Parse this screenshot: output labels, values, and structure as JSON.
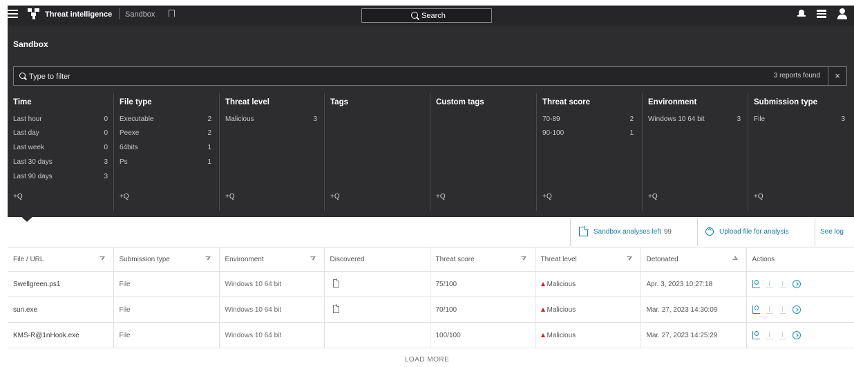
{
  "topbar": {
    "app_title": "Threat intelligence",
    "section": "Sandbox",
    "search_label": "Search"
  },
  "page": {
    "title": "Sandbox"
  },
  "filter": {
    "placeholder": "Type to filter",
    "count_text": "3 reports found",
    "clear_label": "×"
  },
  "facets": [
    {
      "title": "Time",
      "items": [
        {
          "label": "Last hour",
          "count": "0"
        },
        {
          "label": "Last day",
          "count": "0"
        },
        {
          "label": "Last week",
          "count": "0"
        },
        {
          "label": "Last 30 days",
          "count": "3"
        },
        {
          "label": "Last 90 days",
          "count": "3"
        }
      ],
      "add": "+Q"
    },
    {
      "title": "File type",
      "items": [
        {
          "label": "Executable",
          "count": "2"
        },
        {
          "label": "Peexe",
          "count": "2"
        },
        {
          "label": "64bits",
          "count": "1"
        },
        {
          "label": "Ps",
          "count": "1"
        }
      ],
      "add": "+Q"
    },
    {
      "title": "Threat level",
      "items": [
        {
          "label": "Malicious",
          "count": "3"
        }
      ],
      "add": "+Q"
    },
    {
      "title": "Tags",
      "items": [],
      "add": "+Q"
    },
    {
      "title": "Custom tags",
      "items": [],
      "add": "+Q"
    },
    {
      "title": "Threat score",
      "items": [
        {
          "label": "70-89",
          "count": "2"
        },
        {
          "label": "90-100",
          "count": "1"
        }
      ],
      "add": "+Q"
    },
    {
      "title": "Environment",
      "items": [
        {
          "label": "Windows 10 64 bit",
          "count": "3"
        }
      ],
      "add": "+Q"
    },
    {
      "title": "Submission type",
      "items": [
        {
          "label": "File",
          "count": "3"
        }
      ],
      "add": "+Q"
    }
  ],
  "actions": {
    "sandbox_label": "Sandbox analyses left",
    "sandbox_count": "99",
    "upload_label": "Upload file for analysis",
    "log_label": "See log"
  },
  "table": {
    "headers": [
      "File / URL",
      "Submission type",
      "Environment",
      "Discovered",
      "Threat score",
      "Threat level",
      "Detonated",
      "Actions"
    ],
    "rows": [
      {
        "file": "Swellgreen.ps1",
        "type": "File",
        "env": "Windows 10 64 bit",
        "score": "75/100",
        "level": "Malicious",
        "detonated": "Apr. 3, 2023 10:27:18"
      },
      {
        "file": "sun.exe",
        "type": "File",
        "env": "Windows 10 64 bit",
        "score": "70/100",
        "level": "Malicious",
        "detonated": "Mar. 27, 2023 14:30:09"
      },
      {
        "file": "KMS-R@1nHook.exe",
        "type": "File",
        "env": "Windows 10 64 bit",
        "score": "100/100",
        "level": "Malicious",
        "detonated": "Mar. 27, 2023 14:25:29"
      }
    ]
  },
  "footer": {
    "load_more": "LOAD MORE"
  },
  "colors": {
    "topbar_bg": "#262628",
    "panel_bg": "#2d2d2f",
    "accent": "#1a7fa6",
    "malicious": "#d42020"
  },
  "icons": [
    "menu-icon",
    "logo-icon",
    "bookmark-icon",
    "search-icon",
    "bell-icon",
    "list-icon",
    "user-icon",
    "filter-search-icon",
    "document-icon",
    "upload-circle-icon",
    "file-icon",
    "report-icon",
    "upload-icon",
    "download-icon",
    "open-circle-icon"
  ]
}
